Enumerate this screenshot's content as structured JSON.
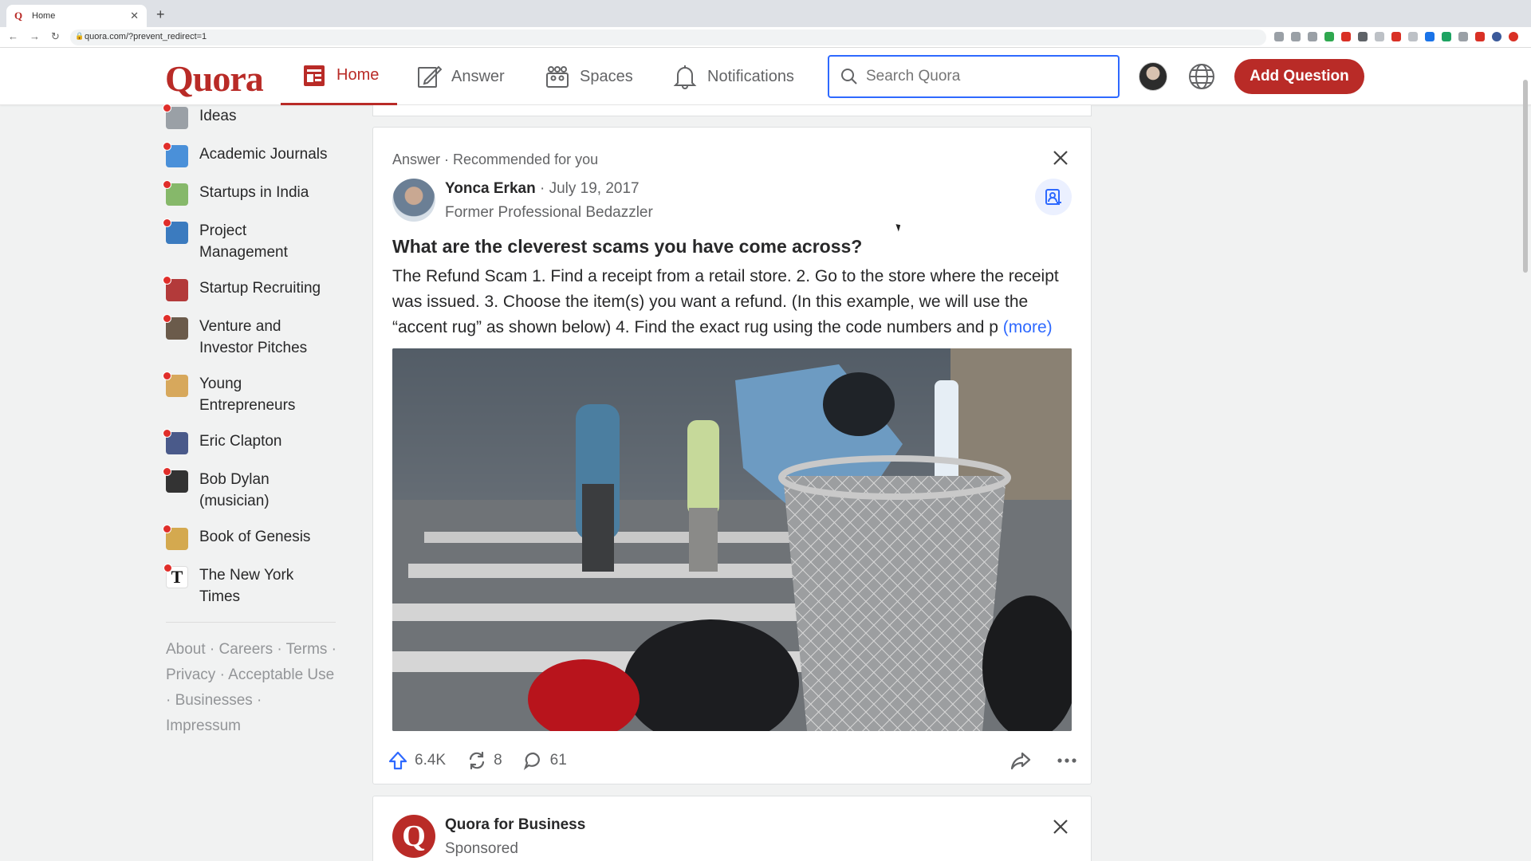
{
  "browser": {
    "tab_title": "Home",
    "tab_favicon": "Q",
    "url": "quora.com/?prevent_redirect=1"
  },
  "header": {
    "logo": "Quora",
    "nav": {
      "home": "Home",
      "answer": "Answer",
      "spaces": "Spaces",
      "notifications": "Notifications"
    },
    "search_placeholder": "Search Quora",
    "add_question": "Add Question",
    "accent_color": "#b92b27"
  },
  "sidebar": {
    "items": [
      {
        "label": "Ideas",
        "thumb": "#9aa0a6"
      },
      {
        "label": "Academic Journals",
        "thumb": "#4a90d9"
      },
      {
        "label": "Startups in India",
        "thumb": "#86b86a"
      },
      {
        "label": "Project Management",
        "thumb": "#3b7bbf"
      },
      {
        "label": "Startup Recruiting",
        "thumb": "#b33a3a"
      },
      {
        "label": "Venture and Investor Pitches",
        "thumb": "#6b5b4b"
      },
      {
        "label": "Young Entrepreneurs",
        "thumb": "#d7a85c"
      },
      {
        "label": "Eric Clapton",
        "thumb": "#4a5a8a"
      },
      {
        "label": "Bob Dylan (musician)",
        "thumb": "#333333"
      },
      {
        "label": "Book of Genesis",
        "thumb": "#d4a94f"
      },
      {
        "label": "The New York Times",
        "thumb": "#111111"
      }
    ],
    "footer": [
      "About",
      "Careers",
      "Terms",
      "Privacy",
      "Acceptable Use",
      "Businesses",
      "Impressum"
    ]
  },
  "post": {
    "meta": "Answer · Recommended for you",
    "author": "Yonca Erkan",
    "date": "· July 19, 2017",
    "credential": "Former Professional Bedazzler",
    "question": "What are the cleverest scams you have come across?",
    "excerpt": "The Refund Scam 1. Find a receipt from a retail store. 2. Go to the store where the receipt was issued. 3. Choose the item(s) you want a refund. (In this example, we will use the “accent rug” as shown below) 4. Find the exact rug using the code numbers and p",
    "more": "(more)",
    "upvotes": "6.4K",
    "shares": "8",
    "comments": "61"
  },
  "sponsored": {
    "name": "Quora for Business",
    "label": "Sponsored",
    "logo_letter": "Q"
  }
}
